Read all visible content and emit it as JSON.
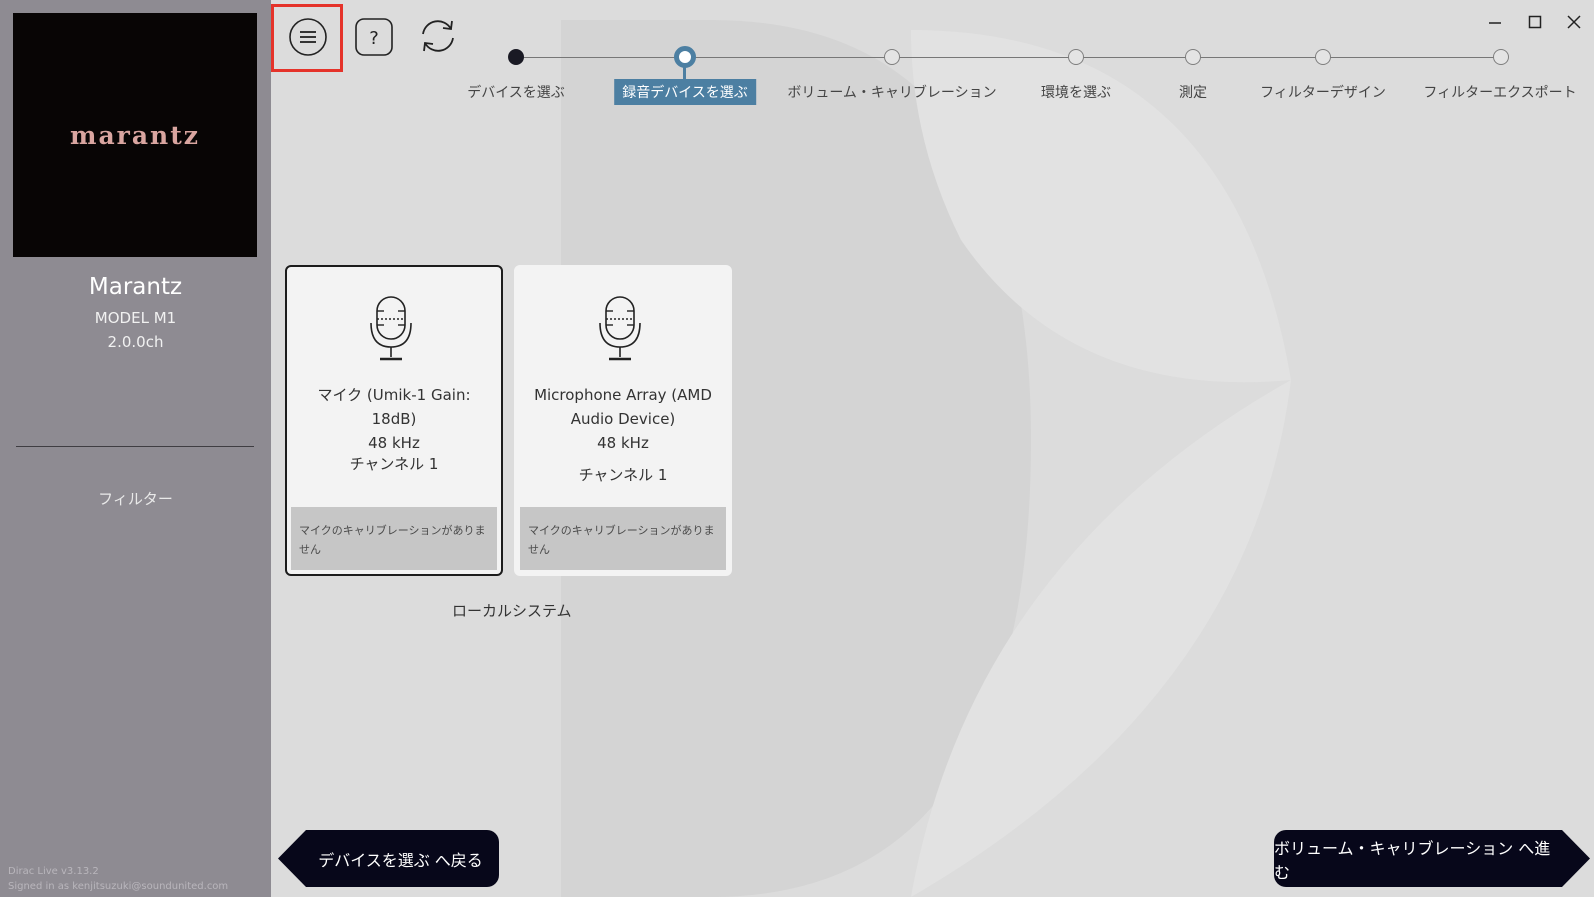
{
  "sidebar": {
    "logo_text": "marantz",
    "device_name": "Marantz",
    "device_model": "MODEL M1",
    "device_channels": "2.0.0ch",
    "filter_label": "フィルター",
    "version": "Dirac Live v3.13.2",
    "signed_in": "Signed in as kenjitsuzuki@soundunited.com"
  },
  "toolbar": {
    "menu_icon": "hamburger-menu-icon",
    "help_icon": "help-icon",
    "refresh_icon": "refresh-icon"
  },
  "window_controls": {
    "minimize": "minimize-icon",
    "maximize": "maximize-icon",
    "close": "close-icon"
  },
  "stepper": {
    "steps": [
      {
        "label": "デバイスを選ぶ",
        "state": "done"
      },
      {
        "label": "録音デバイスを選ぶ",
        "state": "active"
      },
      {
        "label": "ボリューム・キャリブレーション",
        "state": "pending"
      },
      {
        "label": "環境を選ぶ",
        "state": "pending"
      },
      {
        "label": "測定",
        "state": "pending"
      },
      {
        "label": "フィルターデザイン",
        "state": "pending"
      },
      {
        "label": "フィルターエクスポート",
        "state": "pending"
      }
    ]
  },
  "devices": [
    {
      "name_line1": "マイク (Umik-1  Gain: 18dB)",
      "name_line2": "",
      "rate": "48 kHz",
      "channel": "チャンネル 1",
      "calibration": "マイクのキャリブレーションがありません",
      "selected": true
    },
    {
      "name_line1": "Microphone Array (AMD",
      "name_line2": "Audio Device)",
      "rate": "48 kHz",
      "channel": "チャンネル 1",
      "calibration": "マイクのキャリブレーションがありません",
      "selected": false
    }
  ],
  "local_system_label": "ローカルシステム",
  "nav": {
    "back_label": "デバイスを選ぶ へ戻る",
    "next_label": "ボリューム・キャリブレーション へ進む"
  },
  "colors": {
    "accent": "#4c7fa2",
    "sidebar_bg": "#8e8b92",
    "highlight": "#e5332a",
    "nav_bg": "#07071a"
  }
}
